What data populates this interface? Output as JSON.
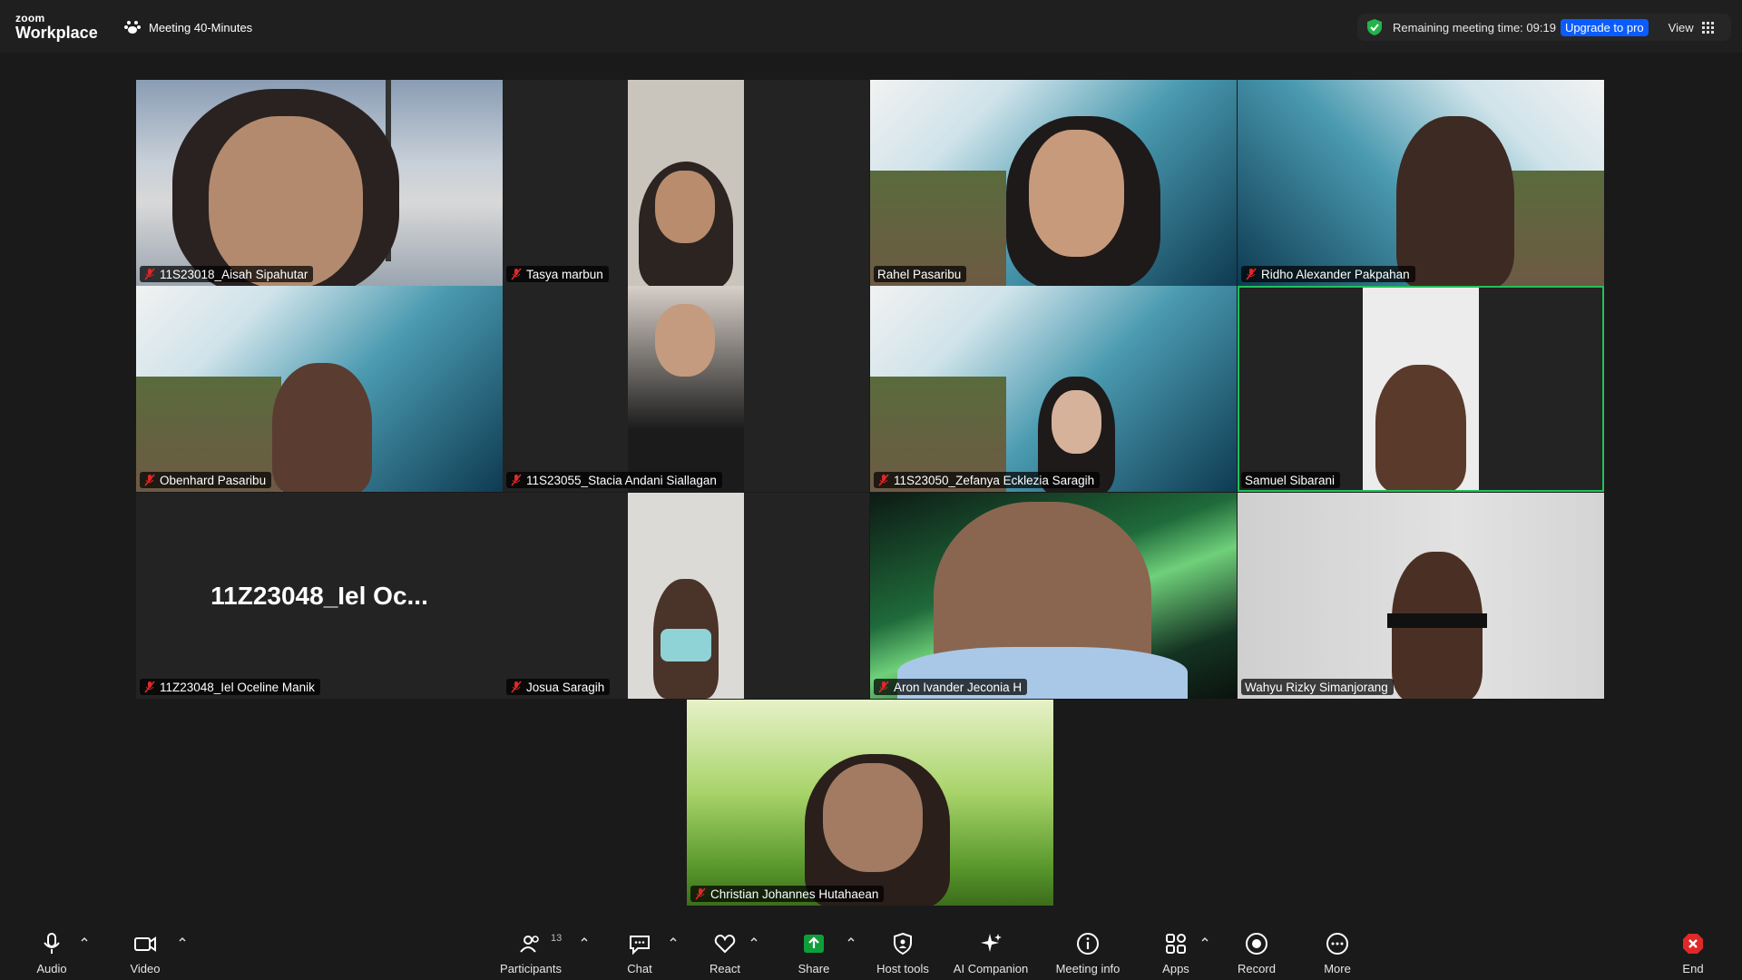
{
  "topbar": {
    "logo_line1": "zoom",
    "logo_line2": "Workplace",
    "meeting_title": "Meeting 40-Minutes",
    "remaining_time": "Remaining meeting time: 09:19",
    "upgrade_label": "Upgrade to pro",
    "view_label": "View"
  },
  "participants": [
    {
      "name": "11S23018_Aisah Sipahutar",
      "muted": true
    },
    {
      "name": "Tasya marbun",
      "muted": true
    },
    {
      "name": "Rahel Pasaribu",
      "muted": false
    },
    {
      "name": "Ridho Alexander Pakpahan",
      "muted": true
    },
    {
      "name": "Obenhard Pasaribu",
      "muted": true
    },
    {
      "name": "11S23055_Stacia Andani Siallagan",
      "muted": true
    },
    {
      "name": "11S23050_Zefanya Ecklezia Saragih",
      "muted": true
    },
    {
      "name": "Samuel Sibarani",
      "muted": false,
      "active_speaker": true
    },
    {
      "name": "11Z23048_Iel Oceline Manik",
      "muted": true,
      "camera_off": true,
      "display_name": "11Z23048_Iel  Oc..."
    },
    {
      "name": "Josua Saragih",
      "muted": true
    },
    {
      "name": "Aron Ivander Jeconia H",
      "muted": true
    },
    {
      "name": "Wahyu Rizky Simanjorang",
      "muted": false
    },
    {
      "name": "Christian Johannes Hutahaean",
      "muted": true
    }
  ],
  "toolbar": {
    "audio": "Audio",
    "video": "Video",
    "participants": "Participants",
    "participants_count": "13",
    "chat": "Chat",
    "react": "React",
    "share": "Share",
    "host_tools": "Host tools",
    "ai_companion": "AI Companion",
    "meeting_info": "Meeting info",
    "apps": "Apps",
    "record": "Record",
    "more": "More",
    "end": "End"
  },
  "colors": {
    "share_green": "#0e9f3b",
    "active_speaker_border": "#21c15b",
    "upgrade_blue": "#0b5cff",
    "mute_red": "#e02828",
    "end_red": "#e02828"
  }
}
